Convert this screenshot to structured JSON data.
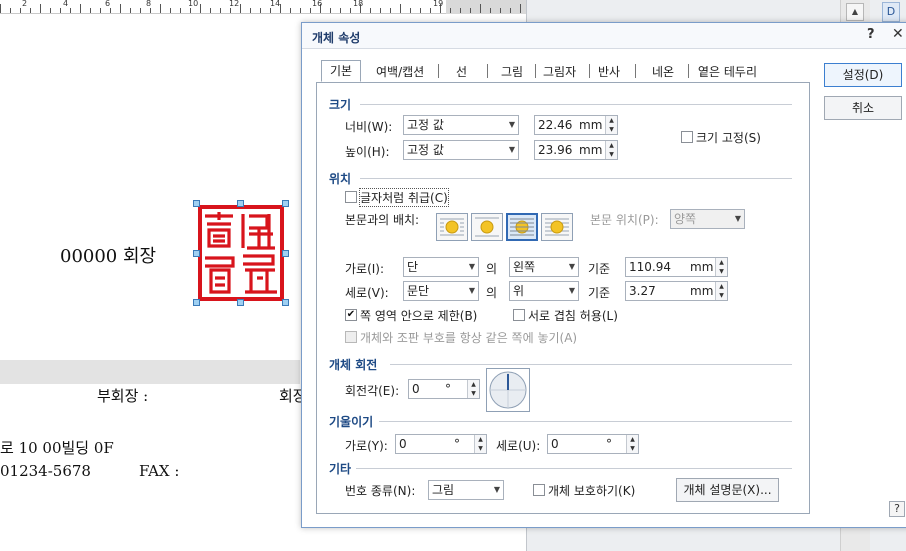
{
  "ruler": {
    "numbers": [
      "2",
      "4",
      "6",
      "8",
      "10",
      "12",
      "14",
      "16",
      "18",
      "19"
    ]
  },
  "document": {
    "chairman_text": "00000  회장",
    "vice_chairman": "부회장 :",
    "chairman_short": "회장",
    "address_line": "로 10 00빌딩 0F",
    "phone_line": "01234-5678",
    "fax_label": "FAX :"
  },
  "side": {
    "d_button": "D",
    "scroll_up": "▲"
  },
  "dialog": {
    "title": "개체 속성",
    "help": "?",
    "close": "✕",
    "tabs": [
      "기본",
      "여백/캡션",
      "선",
      "그림",
      "그림자",
      "반사",
      "네온",
      "옅은 테두리"
    ],
    "ok_button": "설정(D)",
    "cancel_button": "취소",
    "size": {
      "section": "크기",
      "width_label": "너비(W):",
      "width_mode": "고정 값",
      "width_value": "22.46",
      "height_label": "높이(H):",
      "height_mode": "고정 값",
      "height_value": "23.96",
      "unit": "mm",
      "fix_size_label": "크기 고정(S)",
      "fix_size_checked": false
    },
    "position": {
      "section": "위치",
      "treat_as_char_label": "글자처럼 취급(C)",
      "treat_as_char_checked": false,
      "wrap_label": "본문과의 배치:",
      "text_pos_label": "본문 위치(P):",
      "text_pos_value": "양쪽",
      "horiz_label": "가로(I):",
      "horiz_ref": "단",
      "horiz_of": "의",
      "horiz_align": "왼쪽",
      "horiz_base": "기준",
      "horiz_value": "110.94",
      "vert_label": "세로(V):",
      "vert_ref": "문단",
      "vert_of": "의",
      "vert_align": "위",
      "vert_base": "기준",
      "vert_value": "3.27",
      "unit": "mm",
      "limit_label": "쪽 영역 안으로 제한(B)",
      "limit_checked": true,
      "overlap_label": "서로 겹침 허용(L)",
      "overlap_checked": false,
      "same_page_label": "개체와 조판 부호를 항상 같은 쪽에 놓기(A)",
      "same_page_checked": false
    },
    "rotation": {
      "section": "개체 회전",
      "angle_label": "회전각(E):",
      "angle_value": "0",
      "angle_unit": "°"
    },
    "skew": {
      "section": "기울이기",
      "horiz_label": "가로(Y):",
      "horiz_value": "0",
      "vert_label": "세로(U):",
      "vert_value": "0",
      "unit": "°"
    },
    "etc": {
      "section": "기타",
      "number_type_label": "번호 종류(N):",
      "number_type_value": "그림",
      "protect_label": "개체 보호하기(K)",
      "protect_checked": false,
      "description_button": "개체 설명문(X)..."
    },
    "bottom_help": "?"
  },
  "colors": {
    "seal_red": "#d8141c",
    "accent_blue": "#1e4a85"
  },
  "icons": [
    "seal-image",
    "wrap-square-icon",
    "wrap-top-bottom-icon",
    "wrap-behind-text-icon",
    "wrap-in-front-icon",
    "rotation-dial-icon"
  ]
}
